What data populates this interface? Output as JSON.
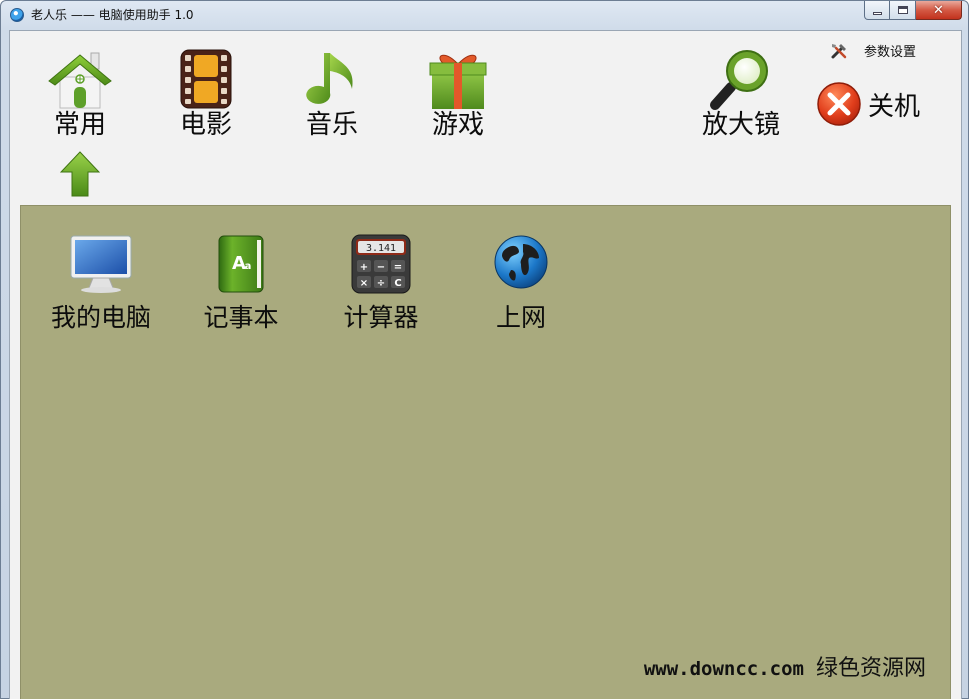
{
  "window": {
    "title": "老人乐 —— 电脑使用助手 1.0"
  },
  "nav": {
    "items": [
      {
        "label": "常用",
        "icon": "home-icon"
      },
      {
        "label": "电影",
        "icon": "film-icon"
      },
      {
        "label": "音乐",
        "icon": "music-note-icon"
      },
      {
        "label": "游戏",
        "icon": "gift-box-icon"
      },
      {
        "label": "放大镜",
        "icon": "magnifier-icon"
      }
    ],
    "active_index": 0
  },
  "settings": {
    "label": "参数设置",
    "icon": "tools-icon"
  },
  "shutdown": {
    "label": "关机",
    "icon": "close-circle-icon"
  },
  "apps": [
    {
      "label": "我的电脑",
      "icon": "monitor-icon"
    },
    {
      "label": "记事本",
      "icon": "notebook-icon"
    },
    {
      "label": "计算器",
      "icon": "calculator-icon"
    },
    {
      "label": "上网",
      "icon": "globe-icon"
    }
  ],
  "calculator_display": "3.141",
  "watermark": {
    "url": "www.downcc.com",
    "site": "绿色资源网"
  },
  "colors": {
    "panel": "#a9aa7e",
    "toolbar": "#f2f2f2",
    "accent_green": "#6aa22a",
    "shutdown_red": "#d9341f"
  }
}
